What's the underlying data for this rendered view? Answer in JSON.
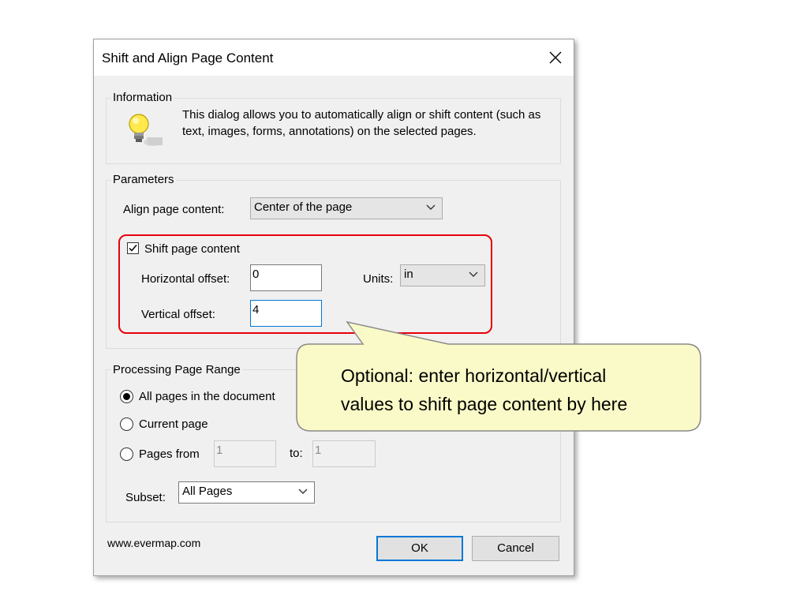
{
  "dialog": {
    "title": "Shift and Align Page Content"
  },
  "information": {
    "label": "Information",
    "text": "This dialog allows you to automatically align or shift content (such as text, images, forms, annotations) on the selected pages.",
    "icon": "lightbulb-icon"
  },
  "parameters": {
    "label": "Parameters",
    "align_label": "Align page content:",
    "align_value": "Center of the page",
    "shift_label": "Shift page content",
    "shift_checked": true,
    "horizontal_label": "Horizontal offset:",
    "horizontal_value": "0",
    "vertical_label": "Vertical offset:",
    "vertical_value": "4",
    "units_label": "Units:",
    "units_value": "in"
  },
  "range": {
    "label": "Processing Page Range",
    "all_pages_label": "All pages in the document",
    "current_page_label": "Current page",
    "pages_from_label": "Pages from",
    "from_value": "1",
    "to_label": "to:",
    "to_value": "1",
    "selected": "all_pages",
    "subset_label": "Subset:",
    "subset_value": "All Pages"
  },
  "footer": {
    "website": "www.evermap.com",
    "ok_label": "OK",
    "cancel_label": "Cancel"
  },
  "callout": {
    "text_line1": "Optional: enter horizontal/vertical",
    "text_line2": "values to shift page content by here",
    "fill": "#fafac8",
    "border": "#8a8a8a"
  },
  "colors": {
    "highlight": "#e8000b",
    "accent": "#0078d7",
    "dialog_bg": "#f0f0f0"
  }
}
